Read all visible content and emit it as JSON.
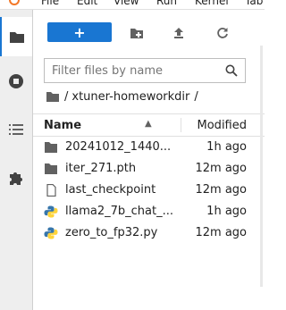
{
  "menu": [
    "File",
    "Edit",
    "View",
    "Run",
    "Kernel",
    "Tab"
  ],
  "sidebar": {
    "tabs": [
      {
        "icon": "folder-icon",
        "active": true
      },
      {
        "icon": "stop-circle-icon",
        "active": false
      },
      {
        "icon": "list-icon",
        "active": false
      },
      {
        "icon": "puzzle-icon",
        "active": false
      }
    ]
  },
  "toolbar": {
    "new_label": "+",
    "new_folder_icon": "new-folder-icon",
    "upload_icon": "upload-icon",
    "refresh_icon": "refresh-icon"
  },
  "search": {
    "placeholder": "Filter files by name"
  },
  "breadcrumb": {
    "root_icon": "folder-icon",
    "separator": "/",
    "path": "xtuner-homeworkdir",
    "trailing": "/"
  },
  "list": {
    "columns": {
      "name": "Name",
      "modified": "Modified"
    },
    "rows": [
      {
        "type": "folder",
        "name": "20241012_1440...",
        "modified": "1h ago"
      },
      {
        "type": "folder",
        "name": "iter_271.pth",
        "modified": "12m ago"
      },
      {
        "type": "file",
        "name": "last_checkpoint",
        "modified": "12m ago"
      },
      {
        "type": "python",
        "name": "llama2_7b_chat_...",
        "modified": "1h ago"
      },
      {
        "type": "python",
        "name": "zero_to_fp32.py",
        "modified": "12m ago"
      }
    ]
  },
  "colors": {
    "accent": "#1976d2",
    "folder": "#616161",
    "python_blue": "#3776ab",
    "python_yellow": "#ffd43b"
  }
}
